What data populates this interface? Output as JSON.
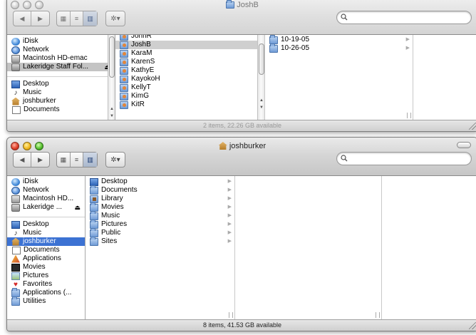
{
  "window1": {
    "title": "JoshB",
    "search": {
      "value": "",
      "placeholder": ""
    },
    "status": "2 items, 22.26 GB available",
    "sidebar": {
      "volumes": [
        {
          "label": "iDisk",
          "icon": "idisk-icon"
        },
        {
          "label": "Network",
          "icon": "network-icon"
        },
        {
          "label": "Macintosh HD-emac",
          "icon": "hard-drive-icon"
        },
        {
          "label": "Lakeridge Staff Fol...",
          "icon": "network-volume-icon",
          "eject": "⏏",
          "selected": true
        }
      ],
      "places": [
        {
          "label": "Desktop",
          "icon": "desktop-icon"
        },
        {
          "label": "Music",
          "icon": "music-icon"
        },
        {
          "label": "joshburker",
          "icon": "home-icon"
        },
        {
          "label": "Documents",
          "icon": "documents-icon"
        }
      ]
    },
    "column1": [
      {
        "label": "JohnR"
      },
      {
        "label": "JoshB",
        "selected": true
      },
      {
        "label": "KaraM"
      },
      {
        "label": "KarenS"
      },
      {
        "label": "KathyE"
      },
      {
        "label": "KayokoH"
      },
      {
        "label": "KellyT"
      },
      {
        "label": "KimG"
      },
      {
        "label": "KitR"
      }
    ],
    "column2": [
      {
        "label": "10-19-05"
      },
      {
        "label": "10-26-05"
      }
    ]
  },
  "window2": {
    "title": "joshburker",
    "search": {
      "value": "",
      "placeholder": ""
    },
    "status": "8 items, 41.53 GB available",
    "sidebar": {
      "volumes": [
        {
          "label": "iDisk",
          "icon": "idisk-icon"
        },
        {
          "label": "Network",
          "icon": "network-icon"
        },
        {
          "label": "Macintosh HD...",
          "icon": "hard-drive-icon"
        },
        {
          "label": "Lakeridge ...",
          "icon": "network-volume-icon",
          "eject": "⏏"
        }
      ],
      "places": [
        {
          "label": "Desktop",
          "icon": "desktop-icon"
        },
        {
          "label": "Music",
          "icon": "music-icon"
        },
        {
          "label": "joshburker",
          "icon": "home-icon",
          "selected": true
        },
        {
          "label": "Documents",
          "icon": "documents-icon"
        },
        {
          "label": "Applications",
          "icon": "applications-icon"
        },
        {
          "label": "Movies",
          "icon": "movies-icon"
        },
        {
          "label": "Pictures",
          "icon": "pictures-icon"
        },
        {
          "label": "Favorites",
          "icon": "favorites-icon"
        },
        {
          "label": "Applications (...",
          "icon": "folder-icon"
        },
        {
          "label": "Utilities",
          "icon": "folder-icon"
        }
      ]
    },
    "column1": [
      {
        "label": "Desktop",
        "icon": "desktop-folder-icon"
      },
      {
        "label": "Documents",
        "icon": "documents-folder-icon"
      },
      {
        "label": "Library",
        "icon": "library-folder-icon"
      },
      {
        "label": "Movies",
        "icon": "movies-folder-icon"
      },
      {
        "label": "Music",
        "icon": "music-folder-icon"
      },
      {
        "label": "Pictures",
        "icon": "pictures-folder-icon"
      },
      {
        "label": "Public",
        "icon": "public-folder-icon"
      },
      {
        "label": "Sites",
        "icon": "sites-folder-icon"
      }
    ]
  },
  "toolbar": {
    "back": "◀",
    "forward": "▶",
    "view_icon": "▦",
    "view_list": "≡",
    "view_column": "▥",
    "action": "✲▾"
  },
  "colors": {
    "selection_blue": "#3c72d3",
    "selection_gray": "#cfcfcf"
  }
}
